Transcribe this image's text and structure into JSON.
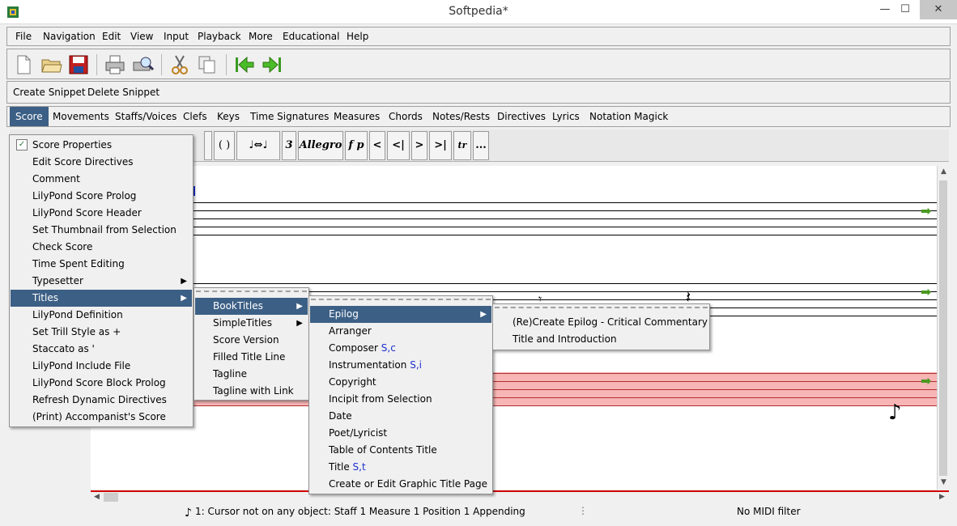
{
  "window": {
    "title": "Softpedia*",
    "min": "—",
    "max": "☐",
    "close": "✕"
  },
  "menubar": [
    "File",
    "Navigation",
    "Edit",
    "View",
    "Input",
    "Playback",
    "More",
    "Educational",
    "Help"
  ],
  "toolbar": [
    "new-file",
    "open-folder",
    "save",
    "print",
    "print-preview",
    "cut",
    "copy",
    "go-first",
    "go-last"
  ],
  "snippets": {
    "create": "Create Snippet",
    "delete": "Delete Snippet"
  },
  "ribbon": [
    "Score",
    "Movements",
    "Staffs/Voices",
    "Clefs",
    "Keys",
    "Time Signatures",
    "Measures",
    "Chords",
    "Notes/Rests",
    "Directives",
    "Lyrics",
    "Notation Magick"
  ],
  "palette": [
    "( )",
    "♩⇔♩",
    "3",
    "Allegro",
    "f p",
    "<",
    "<|",
    ">",
    ">|",
    "tr",
    "..."
  ],
  "score_menu": {
    "items": [
      "Score Properties",
      "Edit Score Directives",
      "Comment",
      "LilyPond Score Prolog",
      "LilyPond Score Header",
      "Set Thumbnail from Selection",
      "Check Score",
      "Time Spent Editing",
      "Typesetter",
      "Titles",
      "LilyPond Definition",
      "Set Trill Style as +",
      "Staccato as '",
      "LilyPond Include File",
      "LilyPond Score Block Prolog",
      "Refresh Dynamic Directives",
      "(Print) Accompanist's Score"
    ]
  },
  "titles_menu": {
    "items": [
      "BookTitles",
      "SimpleTitles",
      "Score Version",
      "Filled Title Line",
      "Tagline",
      "Tagline with Link"
    ]
  },
  "booktitles_menu": {
    "items": [
      "Epilog",
      "Arranger",
      "Composer",
      "Instrumentation",
      "Copyright",
      "Incipit from Selection",
      "Date",
      "Poet/Lyricist",
      "Table of Contents Title",
      "Title",
      "Create or Edit Graphic Title Page"
    ],
    "accels": {
      "composer": "S,c",
      "instrumentation": "S,i",
      "title": "S,t"
    }
  },
  "epilog_menu": {
    "items": [
      "(Re)Create Epilog - Critical Commentary",
      "Title and Introduction"
    ]
  },
  "status": {
    "message": "1: Cursor not on any object:  Staff 1 Measure 1 Position 1 Appending",
    "separator": "⋮",
    "midi": "No MIDI filter"
  }
}
